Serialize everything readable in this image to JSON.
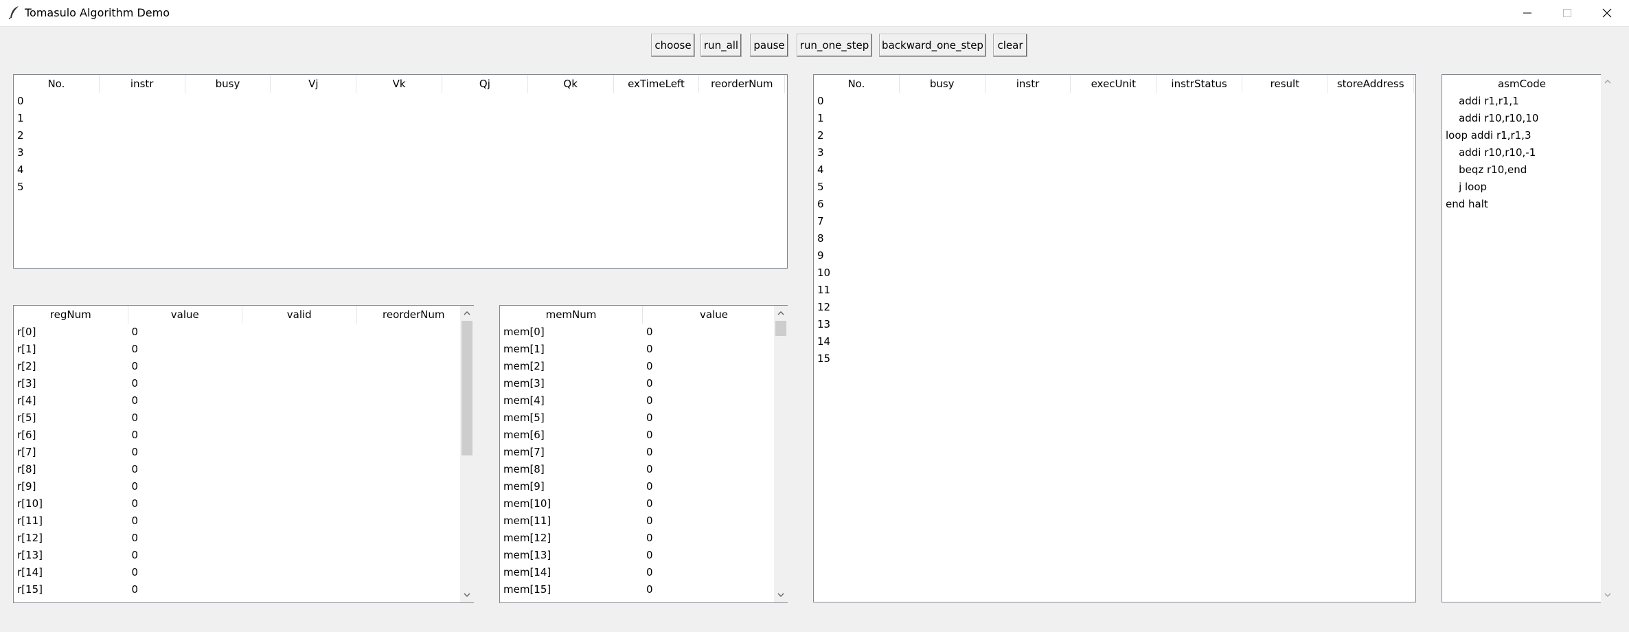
{
  "window": {
    "title": "Tomasulo Algorithm Demo"
  },
  "toolbar": {
    "buttons": [
      "choose",
      "run_all",
      "pause",
      "run_one_step",
      "backward_one_step",
      "clear"
    ]
  },
  "reservation_station": {
    "columns": [
      "No.",
      "instr",
      "busy",
      "Vj",
      "Vk",
      "Qj",
      "Qk",
      "exTimeLeft",
      "reorderNum"
    ],
    "rows": [
      "0",
      "1",
      "2",
      "3",
      "4",
      "5"
    ]
  },
  "reorder_buffer": {
    "columns": [
      "No.",
      "busy",
      "instr",
      "execUnit",
      "instrStatus",
      "result",
      "storeAddress"
    ],
    "rows": [
      "0",
      "1",
      "2",
      "3",
      "4",
      "5",
      "6",
      "7",
      "8",
      "9",
      "10",
      "11",
      "12",
      "13",
      "14",
      "15"
    ]
  },
  "asm": {
    "header": "asmCode",
    "lines": [
      "    addi r1,r1,1",
      "    addi r10,r10,10",
      "loop addi r1,r1,3",
      "    addi r10,r10,-1",
      "    beqz r10,end",
      "    j loop",
      "end halt"
    ]
  },
  "registers": {
    "columns": [
      "regNum",
      "value",
      "valid",
      "reorderNum"
    ],
    "rows": [
      [
        "r[0]",
        "0"
      ],
      [
        "r[1]",
        "0"
      ],
      [
        "r[2]",
        "0"
      ],
      [
        "r[3]",
        "0"
      ],
      [
        "r[4]",
        "0"
      ],
      [
        "r[5]",
        "0"
      ],
      [
        "r[6]",
        "0"
      ],
      [
        "r[7]",
        "0"
      ],
      [
        "r[8]",
        "0"
      ],
      [
        "r[9]",
        "0"
      ],
      [
        "r[10]",
        "0"
      ],
      [
        "r[11]",
        "0"
      ],
      [
        "r[12]",
        "0"
      ],
      [
        "r[13]",
        "0"
      ],
      [
        "r[14]",
        "0"
      ],
      [
        "r[15]",
        "0"
      ]
    ]
  },
  "memory": {
    "columns": [
      "memNum",
      "value"
    ],
    "rows": [
      [
        "mem[0]",
        "0"
      ],
      [
        "mem[1]",
        "0"
      ],
      [
        "mem[2]",
        "0"
      ],
      [
        "mem[3]",
        "0"
      ],
      [
        "mem[4]",
        "0"
      ],
      [
        "mem[5]",
        "0"
      ],
      [
        "mem[6]",
        "0"
      ],
      [
        "mem[7]",
        "0"
      ],
      [
        "mem[8]",
        "0"
      ],
      [
        "mem[9]",
        "0"
      ],
      [
        "mem[10]",
        "0"
      ],
      [
        "mem[11]",
        "0"
      ],
      [
        "mem[12]",
        "0"
      ],
      [
        "mem[13]",
        "0"
      ],
      [
        "mem[14]",
        "0"
      ],
      [
        "mem[15]",
        "0"
      ]
    ]
  }
}
